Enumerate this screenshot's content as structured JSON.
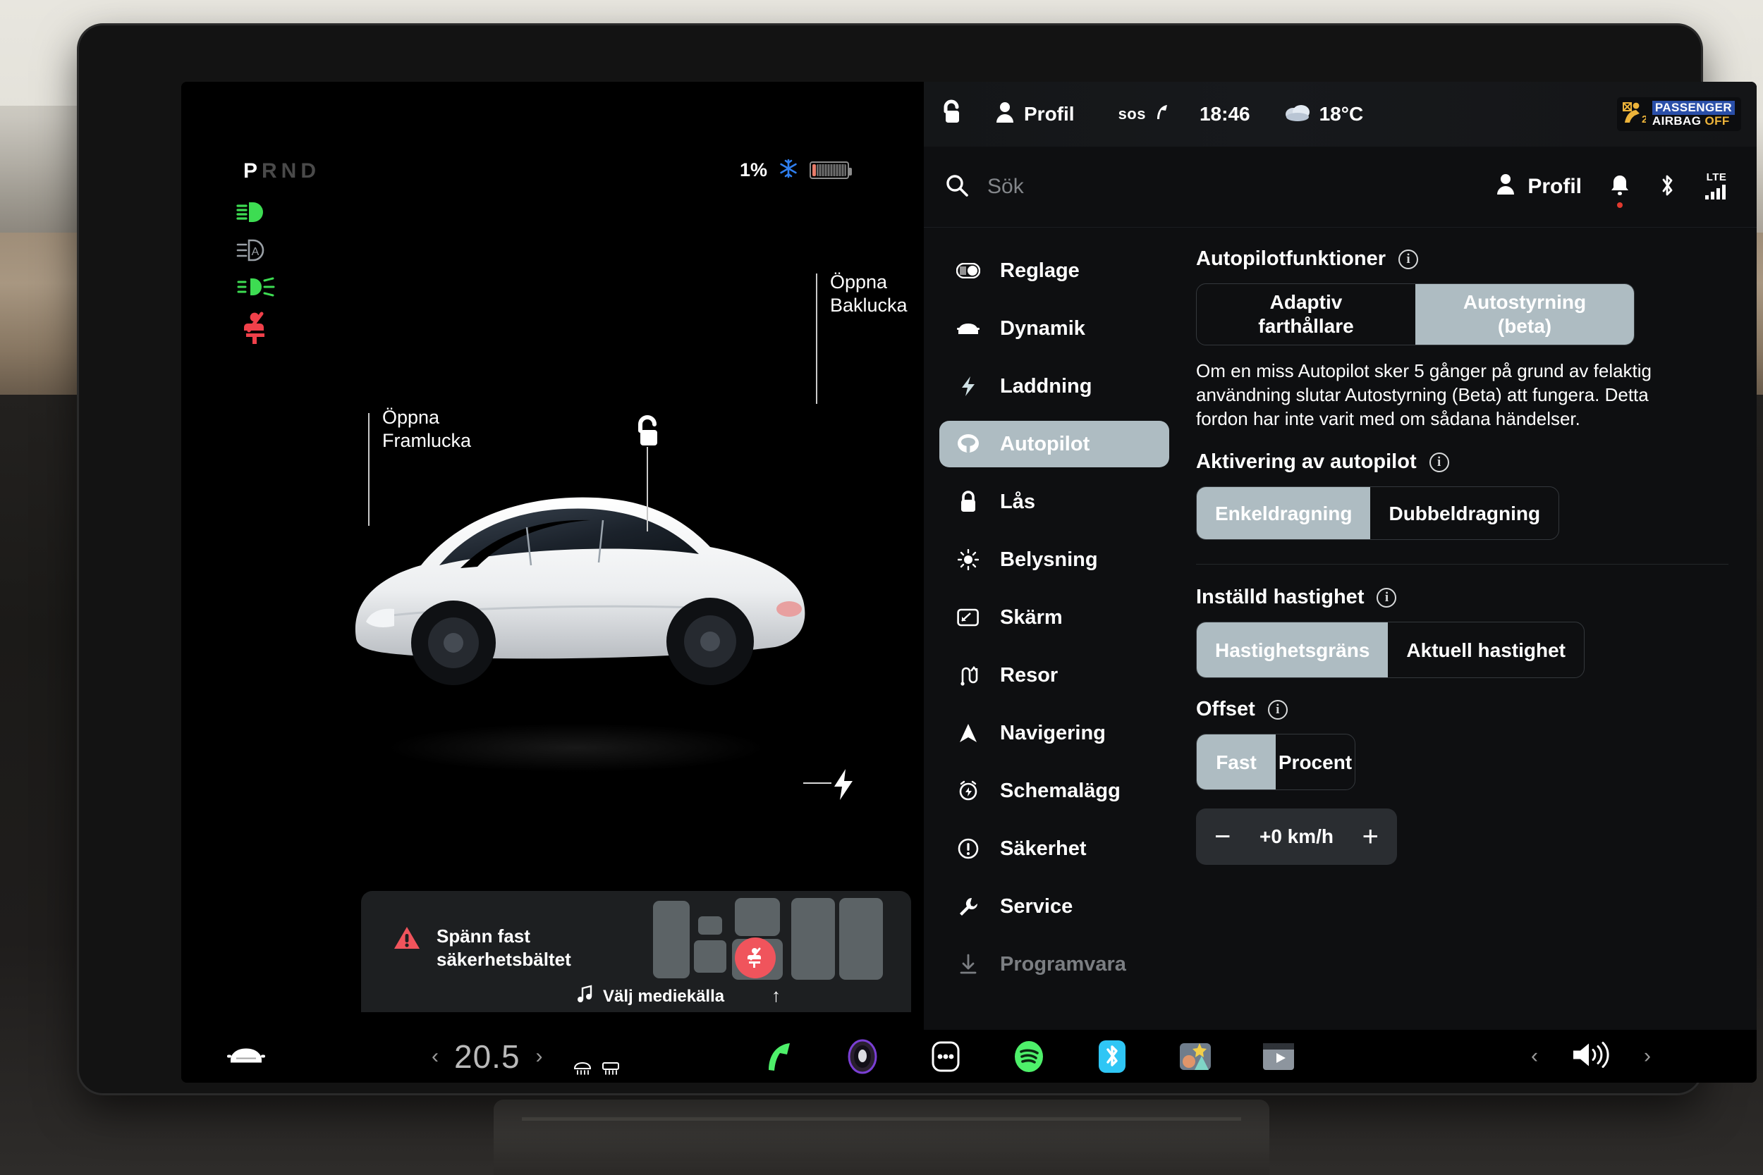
{
  "vehicle_cluster": {
    "gear_indicator": "PRND",
    "active_gear": "P",
    "battery_percent": "1%",
    "battery_color": "#e87c6a",
    "telltales": [
      {
        "name": "high-beam-icon",
        "color": "#3ddc52"
      },
      {
        "name": "auto-high-beam-icon",
        "color": "#9aa0a6"
      },
      {
        "name": "fog-light-icon",
        "color": "#3ddc52"
      },
      {
        "name": "seatbelt-warning-icon",
        "color": "#f0404a"
      }
    ],
    "climate_snowflake_color": "#2f7ff0"
  },
  "car_callouts": {
    "front_trunk": "Öppna\nFramlucka",
    "rear_trunk": "Öppna\nBaklucka",
    "lock_state_icon": "unlock-icon",
    "charge_port_icon": "lightning-bolt-icon"
  },
  "seat_card": {
    "warning_text": "Spänn fast\nsäkerhetsbältet",
    "warning_color": "#f0404a",
    "media_source_label": "Välj mediekälla",
    "music_icon": "music-note-icon",
    "expand_icon": "arrow-up-icon"
  },
  "status_bar": {
    "lock_icon": "unlock-icon",
    "profile_icon": "person-icon",
    "profile_label": "Profil",
    "sos_label": "sos",
    "time": "18:46",
    "weather_icon": "cloud-icon",
    "temperature": "18°C",
    "airbag_badge": {
      "line1": "PASSENGER",
      "line2_prefix": "AIRBAG",
      "line2_status": "OFF",
      "status_color": "#ecb33a",
      "seat_count": "2",
      "icon": "passenger-airbag-off-icon"
    }
  },
  "app_bar": {
    "search_icon": "search-icon",
    "search_placeholder": "Sök",
    "search_value": "",
    "profile_icon": "person-icon",
    "profile_label": "Profil",
    "bell_icon": "bell-icon",
    "bell_has_badge": true,
    "bluetooth_icon": "bluetooth-icon",
    "network_label": "LTE",
    "signal_icon": "signal-bars-icon"
  },
  "sidebar": {
    "items": [
      {
        "label": "Reglage",
        "icon": "toggle-icon",
        "active": false,
        "faded": false
      },
      {
        "label": "Dynamik",
        "icon": "car-front-icon",
        "active": false,
        "faded": false
      },
      {
        "label": "Laddning",
        "icon": "bolt-icon",
        "active": false,
        "faded": false
      },
      {
        "label": "Autopilot",
        "icon": "steering-wheel-icon",
        "active": true,
        "faded": false
      },
      {
        "label": "Lås",
        "icon": "lock-icon",
        "active": false,
        "faded": false
      },
      {
        "label": "Belysning",
        "icon": "brightness-icon",
        "active": false,
        "faded": false
      },
      {
        "label": "Skärm",
        "icon": "display-icon",
        "active": false,
        "faded": false
      },
      {
        "label": "Resor",
        "icon": "trips-icon",
        "active": false,
        "faded": false
      },
      {
        "label": "Navigering",
        "icon": "navigation-arrow-icon",
        "active": false,
        "faded": false
      },
      {
        "label": "Schemalägg",
        "icon": "alarm-clock-icon",
        "active": false,
        "faded": false
      },
      {
        "label": "Säkerhet",
        "icon": "exclamation-circle-icon",
        "active": false,
        "faded": false
      },
      {
        "label": "Service",
        "icon": "wrench-icon",
        "active": false,
        "faded": false
      },
      {
        "label": "Programvara",
        "icon": "download-icon",
        "active": false,
        "faded": true
      }
    ]
  },
  "autopilot": {
    "features": {
      "title": "Autopilotfunktioner",
      "options": [
        "Adaptiv\nfarthållare",
        "Autostyrning\n(beta)"
      ],
      "selected_index": 1,
      "description": "Om en miss Autopilot sker 5 gånger på grund av felaktig användning slutar Autostyrning (Beta) att fungera. Detta fordon har inte varit med om sådana händelser."
    },
    "engagement": {
      "title": "Aktivering av autopilot",
      "options": [
        "Enkeldragning",
        "Dubbeldragning"
      ],
      "selected_index": 0
    },
    "set_speed": {
      "title": "Inställd hastighet",
      "options": [
        "Hastighetsgräns",
        "Aktuell hastighet"
      ],
      "selected_index": 0
    },
    "offset": {
      "title": "Offset",
      "options": [
        "Fast",
        "Procent"
      ],
      "selected_index": 0,
      "value": "+0 km/h",
      "decrement_label": "−",
      "increment_label": "+"
    },
    "selected_accent": "#aebcc2"
  },
  "dock": {
    "car_icon": "car-front-icon",
    "temperature": "20.5",
    "prev_icon": "chevron-left-icon",
    "next_icon": "chevron-right-icon",
    "defroster_icons": [
      "front-defrost-icon",
      "rear-defrost-icon"
    ],
    "apps": [
      {
        "name": "phone-app-icon",
        "color": "#4ef06a"
      },
      {
        "name": "media-app-icon",
        "color": "#7a3fd4"
      },
      {
        "name": "more-apps-icon",
        "color": "#ffffff"
      },
      {
        "name": "spotify-app-icon",
        "color": "#4ef06a"
      },
      {
        "name": "bluetooth-app-icon",
        "color": "#2fc6f5"
      },
      {
        "name": "photos-app-icon",
        "color": "#d6a26a"
      },
      {
        "name": "theater-app-icon",
        "color": "#9aa0a6"
      }
    ],
    "volume_icon": "volume-icon",
    "volume_prev_icon": "chevron-left-icon",
    "volume_next_icon": "chevron-right-icon"
  }
}
